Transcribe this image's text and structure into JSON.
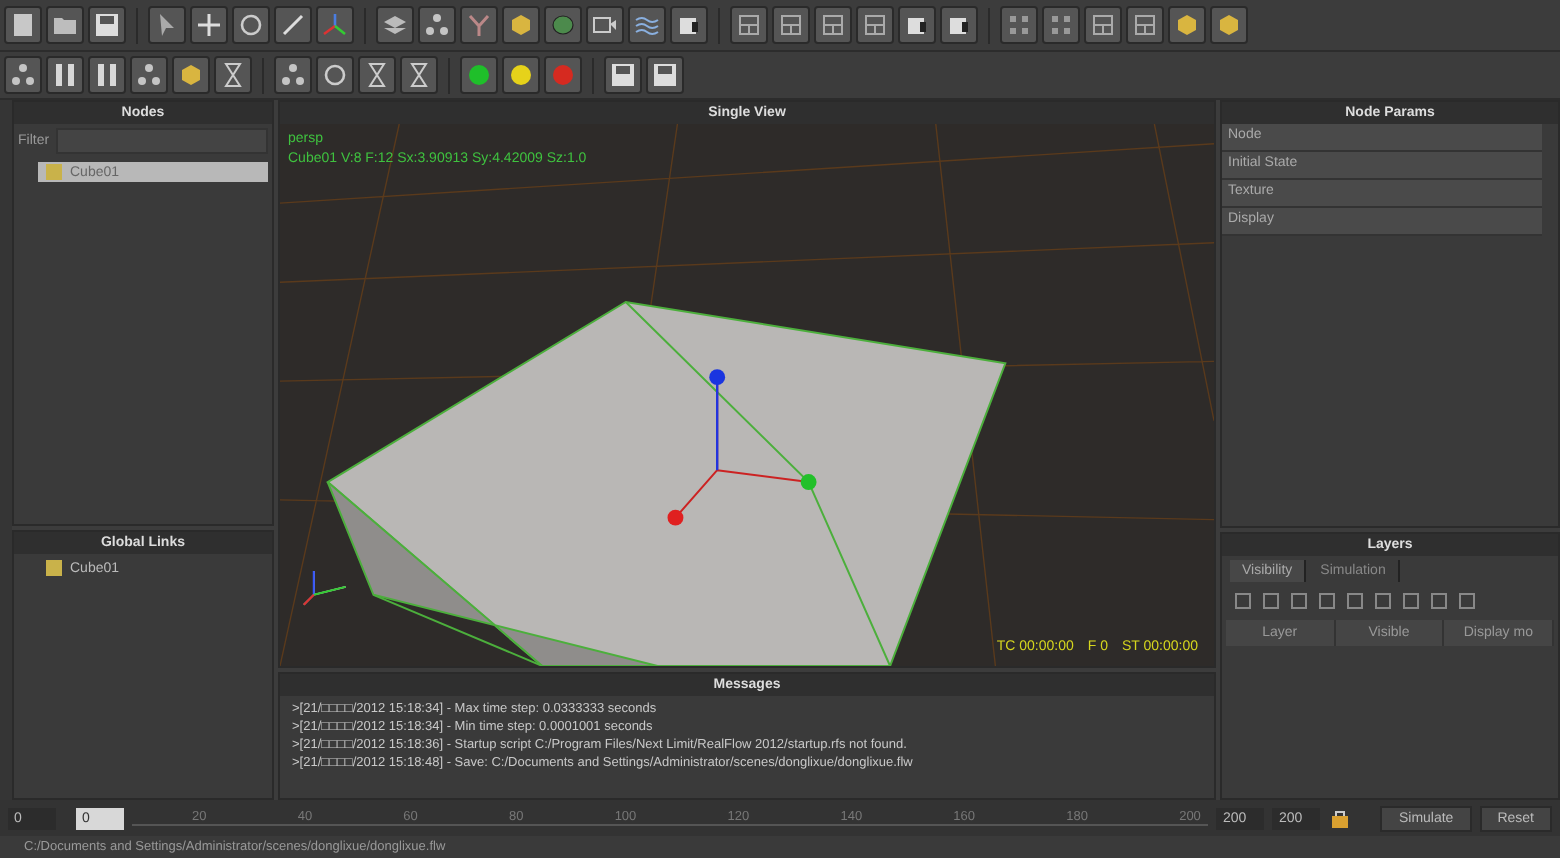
{
  "nodes_panel": {
    "title": "Nodes",
    "filter_label": "Filter",
    "items": [
      {
        "label": "Cube01",
        "selected": true
      }
    ]
  },
  "global_links": {
    "title": "Global Links",
    "items": [
      {
        "label": "Cube01"
      }
    ]
  },
  "viewport": {
    "title": "Single View",
    "camera": "persp",
    "info": "Cube01 V:8 F:12 Sx:3.90913 Sy:4.42009 Sz:1.0",
    "timecode": "TC 00:00:00",
    "frame": "F 0",
    "sim_time": "ST 00:00:00"
  },
  "messages": {
    "title": "Messages",
    "lines": [
      ">[21/□□□□/2012 15:18:34] - Max time step: 0.0333333 seconds",
      ">[21/□□□□/2012 15:18:34] - Min time step: 0.0001001 seconds",
      ">[21/□□□□/2012 15:18:36] - Startup script C:/Program Files/Next Limit/RealFlow 2012/startup.rfs not found.",
      ">[21/□□□□/2012 15:18:48] - Save: C:/Documents and Settings/Administrator/scenes/donglixue/donglixue.flw"
    ]
  },
  "node_params": {
    "title": "Node Params",
    "sections": [
      "Node",
      "Initial State",
      "Texture",
      "Display"
    ]
  },
  "layers": {
    "title": "Layers",
    "tabs": [
      {
        "label": "Visibility",
        "selected": true
      },
      {
        "label": "Simulation",
        "selected": false
      }
    ],
    "columns": [
      "Layer",
      "Visible",
      "Display mo"
    ]
  },
  "timeline": {
    "start": "0",
    "current": "0",
    "ticks": [
      "20",
      "40",
      "60",
      "80",
      "100",
      "120",
      "140",
      "160",
      "180",
      "200"
    ],
    "end": "200",
    "max": "200"
  },
  "buttons": [
    {
      "label": "Simulate"
    },
    {
      "label": "Reset"
    }
  ],
  "status_bar": "C:/Documents and Settings/Administrator/scenes/donglixue/donglixue.flw"
}
